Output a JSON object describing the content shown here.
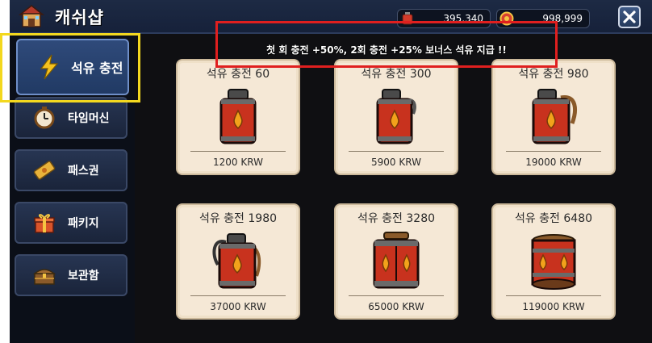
{
  "header": {
    "title": "캐쉬샵",
    "shop_icon": "shop-house-icon",
    "currencies": [
      {
        "icon": "oil-can-icon",
        "value": "395,340"
      },
      {
        "icon": "gold-coin-icon",
        "value": "998,999"
      }
    ],
    "close_icon": "close-icon"
  },
  "sidebar": {
    "items": [
      {
        "label": "석유 충전",
        "icon": "lightning-icon",
        "active": true
      },
      {
        "label": "타임머신",
        "icon": "clock-icon"
      },
      {
        "label": "패스권",
        "icon": "ticket-icon"
      },
      {
        "label": "패키지",
        "icon": "gift-box-icon"
      },
      {
        "label": "보관함",
        "icon": "treasure-chest-icon"
      }
    ]
  },
  "banner": {
    "text": "첫 회 충전 +50%, 2회 충전 +25%  보너스 석유 지급 !!"
  },
  "products": [
    {
      "title": "석유 충전 60",
      "price": "1200 KRW",
      "icon": "oil-jerrycan-icon"
    },
    {
      "title": "석유 충전 300",
      "price": "5900 KRW",
      "icon": "oil-jerrycan-icon"
    },
    {
      "title": "석유 충전 980",
      "price": "19000 KRW",
      "icon": "oil-jerrycan-icon"
    },
    {
      "title": "석유 충전 1980",
      "price": "37000 KRW",
      "icon": "oil-jerrycan-icon"
    },
    {
      "title": "석유 충전 3280",
      "price": "65000 KRW",
      "icon": "oil-jerrycan-icon"
    },
    {
      "title": "석유 충전 6480",
      "price": "119000 KRW",
      "icon": "oil-barrel-icon"
    }
  ],
  "colors": {
    "highlight_yellow": "#f3d81f",
    "highlight_red": "#e01f1f",
    "card_bg": "#f5e8d6",
    "oil_red": "#c8321e",
    "oil_drop": "#f2a21b"
  }
}
